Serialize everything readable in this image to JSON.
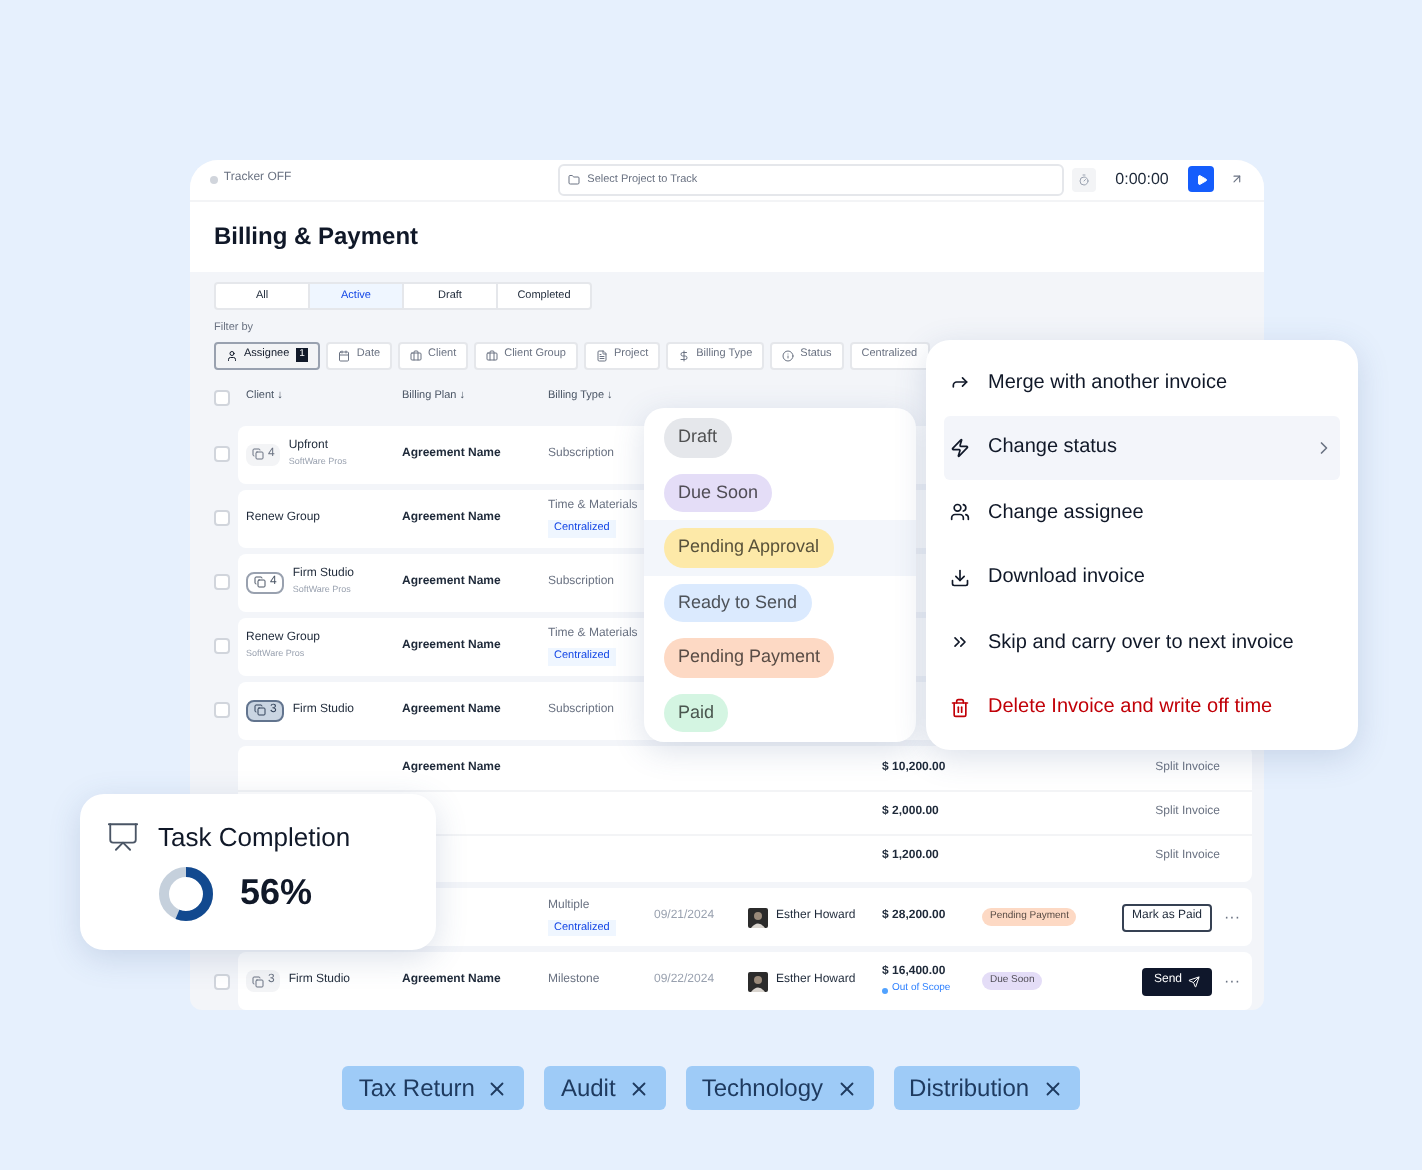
{
  "topbar": {
    "tracker": "Tracker OFF",
    "project_placeholder": "Select Project to Track",
    "timer": "0:00:00"
  },
  "title": "Billing & Payment",
  "tabs": [
    {
      "label": "All",
      "selected": false
    },
    {
      "label": "Active",
      "selected": true
    },
    {
      "label": "Draft",
      "selected": false
    },
    {
      "label": "Completed",
      "selected": false
    }
  ],
  "filter_label": "Filter by",
  "filters": [
    {
      "label": "Assignee",
      "count": "1",
      "selected": true
    },
    {
      "label": "Date",
      "selected": false
    },
    {
      "label": "Client",
      "selected": false
    },
    {
      "label": "Client Group",
      "selected": false
    },
    {
      "label": "Project",
      "selected": false
    },
    {
      "label": "Billing Type",
      "selected": false
    },
    {
      "label": "Status",
      "selected": false
    },
    {
      "label": "Centralized",
      "selected": false
    }
  ],
  "select_all": {
    "checked": false
  },
  "columns": [
    "Client ↓",
    "Billing Plan ↓",
    "Billing Type ↓"
  ],
  "rows": [
    {
      "kind": "row",
      "checked": false,
      "badge": {
        "count": "4",
        "kind": "plain"
      },
      "client": "Upfront",
      "client_sub": "SoftWare Pros",
      "plan": "Agreement Name",
      "type": "Subscription"
    },
    {
      "kind": "row",
      "checked": false,
      "client": "Renew Group",
      "plan": "Agreement Name",
      "type": "Time & Materials",
      "type_tag": "Centralized"
    },
    {
      "kind": "row",
      "checked": false,
      "badge": {
        "count": "4",
        "kind": "outlined"
      },
      "client": "Firm Studio",
      "client_sub": "SoftWare Pros",
      "plan": "Agreement Name",
      "type": "Subscription"
    },
    {
      "kind": "row",
      "checked": false,
      "client": "Renew Group",
      "client_sub": "SoftWare Pros",
      "plan": "Agreement Name",
      "type": "Time & Materials",
      "type_tag": "Centralized"
    },
    {
      "kind": "row",
      "checked": false,
      "badge": {
        "count": "3",
        "kind": "filled"
      },
      "client": "Firm Studio",
      "plan": "Agreement Name",
      "type": "Subscription"
    },
    {
      "kind": "group",
      "lines": [
        {
          "plan": "Agreement Name",
          "currency": "$",
          "amount": "10,200.00",
          "action": "Split Invoice"
        },
        {
          "currency": "$",
          "amount": "2,000.00",
          "action": "Split Invoice"
        },
        {
          "currency": "$",
          "amount": "1,200.00",
          "action": "Split Invoice"
        }
      ]
    },
    {
      "kind": "row",
      "type": "Multiple",
      "type_tag": "Centralized",
      "date": "09/21/2024",
      "assignee": "Esther Howard",
      "currency": "$",
      "amount": "28,200.00",
      "status": {
        "label": "Pending Payment",
        "color": "#fdd9c4"
      },
      "action": {
        "kind": "outline",
        "label": "Mark as Paid"
      },
      "more": "···"
    },
    {
      "kind": "row",
      "checked": false,
      "badge": {
        "count": "3",
        "kind": "plain"
      },
      "client": "Firm Studio",
      "plan": "Agreement Name",
      "type": "Milestone",
      "date": "09/22/2024",
      "assignee": "Esther Howard",
      "currency": "$",
      "amount": "16,400.00",
      "note": "Out of Scope",
      "status": {
        "label": "Due Soon",
        "color": "#e4ddf7"
      },
      "action": {
        "kind": "dark",
        "label": "Send"
      },
      "more": "···"
    }
  ],
  "status_menu": [
    {
      "label": "Draft",
      "color": "#e5e7eb",
      "selected": false
    },
    {
      "label": "Due Soon",
      "color": "#e4ddf7",
      "selected": false
    },
    {
      "label": "Pending Approval",
      "color": "#fde9a8",
      "selected": true
    },
    {
      "label": "Ready to Send",
      "color": "#dbeafe",
      "selected": false
    },
    {
      "label": "Pending Payment",
      "color": "#fdd9c4",
      "selected": false
    },
    {
      "label": "Paid",
      "color": "#d4f5e2",
      "selected": false
    }
  ],
  "context_menu": [
    {
      "label": "Merge with another invoice",
      "kind": "normal",
      "selected": false,
      "submenu": false
    },
    {
      "label": "Change status",
      "kind": "normal",
      "selected": true,
      "submenu": true
    },
    {
      "label": "Change assignee",
      "kind": "normal",
      "selected": false,
      "submenu": false
    },
    {
      "label": "Download invoice",
      "kind": "normal",
      "selected": false,
      "submenu": false
    },
    {
      "label": "Skip and carry over to next invoice",
      "kind": "normal",
      "selected": false,
      "submenu": false
    },
    {
      "label": "Delete Invoice and write off time",
      "kind": "danger",
      "selected": false,
      "submenu": false
    }
  ],
  "task_card": {
    "title": "Task Completion",
    "level": 0.56,
    "reading": "56%"
  },
  "tags": [
    "Tax Return",
    "Audit",
    "Technology",
    "Distribution"
  ]
}
